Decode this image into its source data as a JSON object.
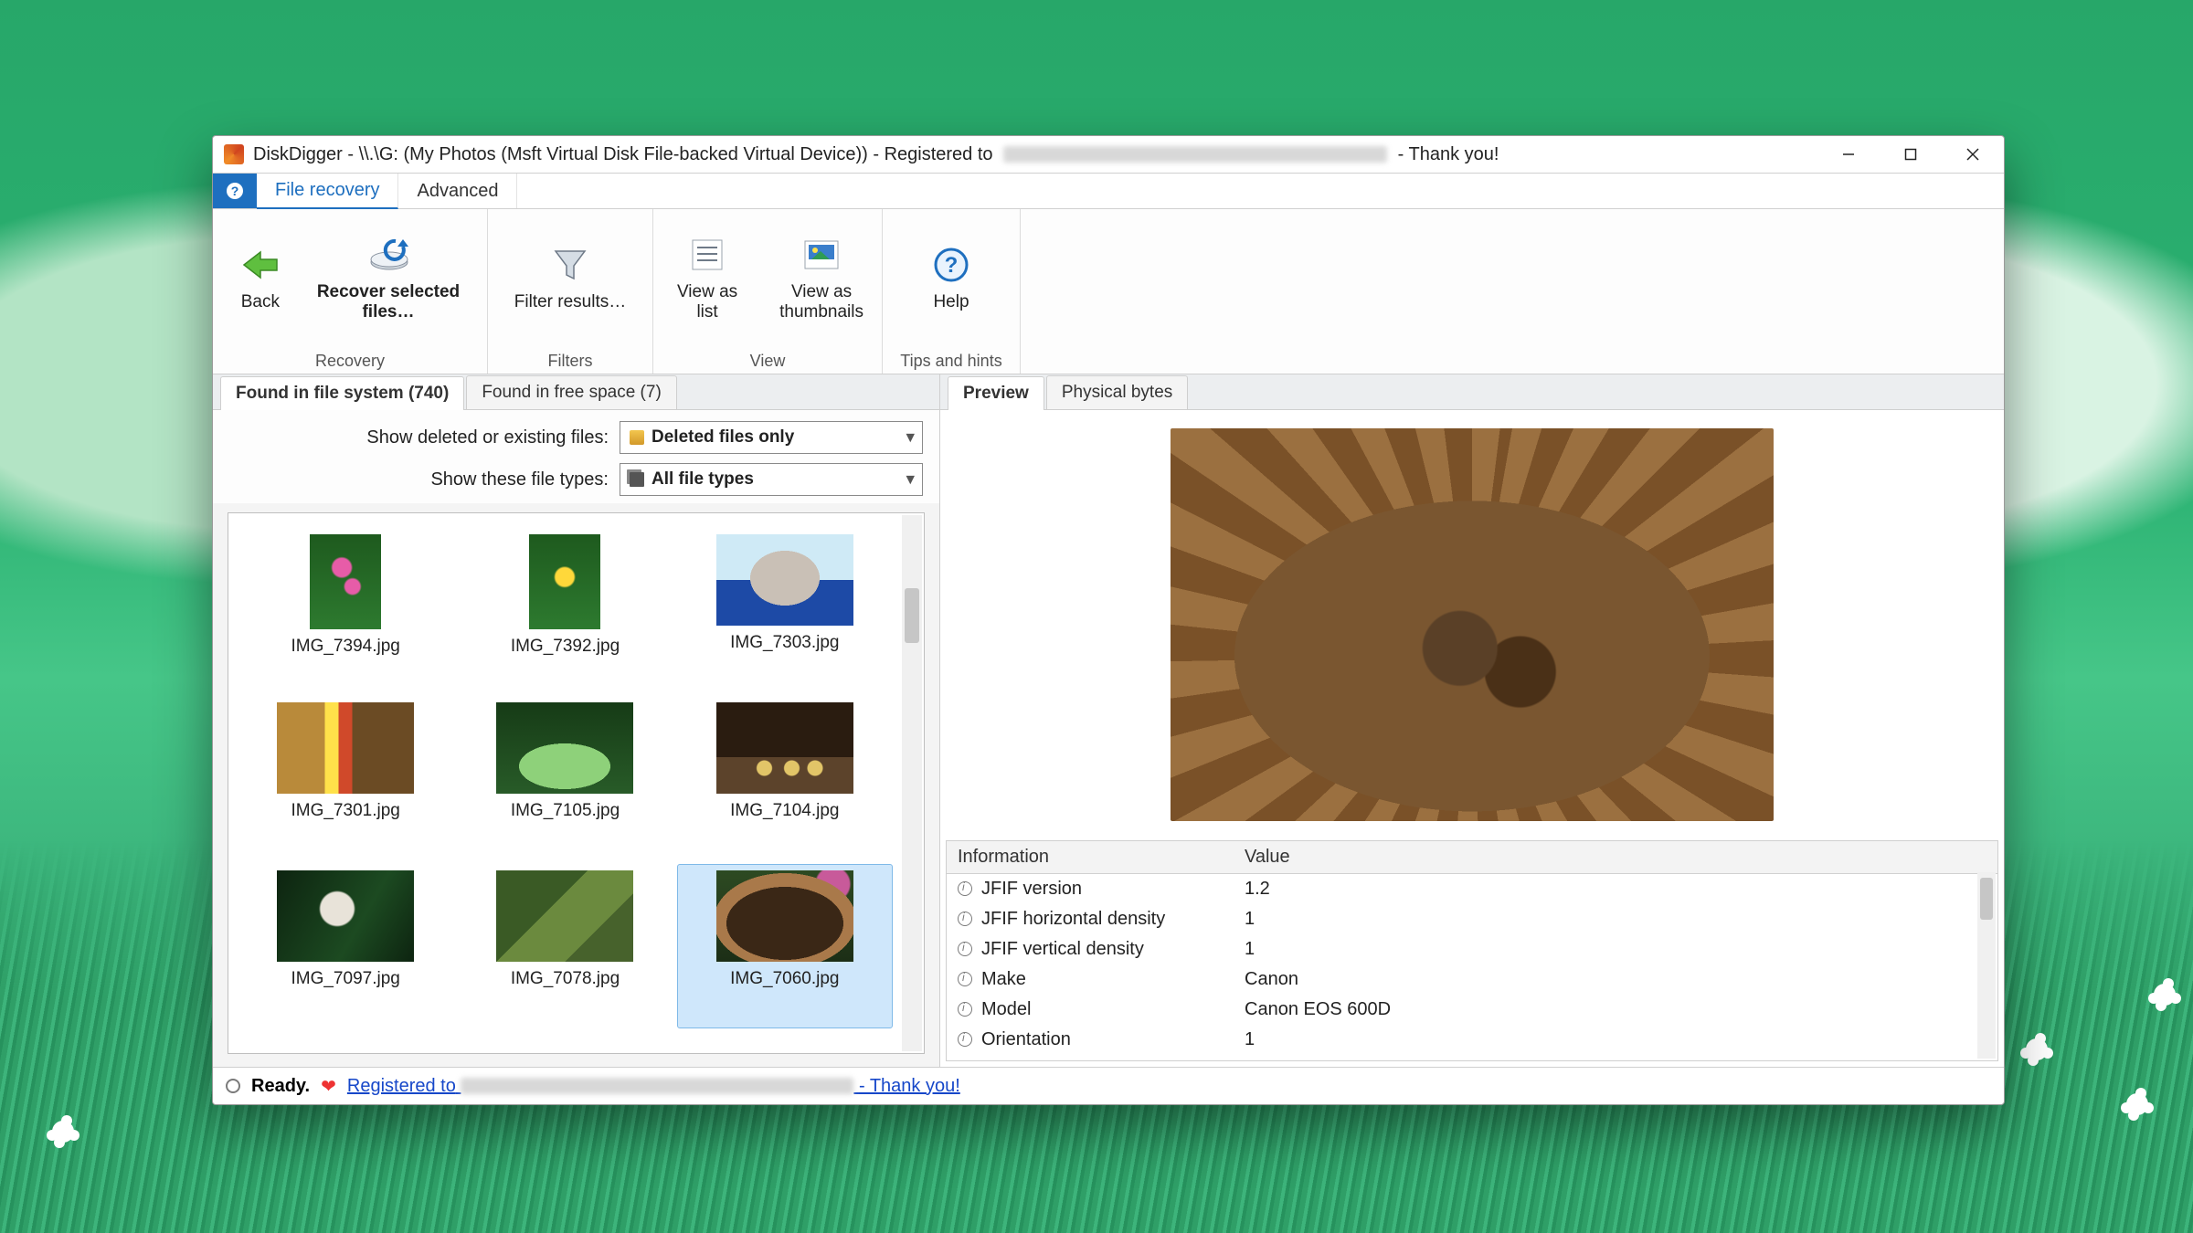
{
  "title": {
    "app": "DiskDigger",
    "path": "\\\\.\\G: (My Photos (Msft Virtual Disk File-backed Virtual Device))",
    "registered_pre": "Registered to",
    "thank": "- Thank you!"
  },
  "menuTabs": {
    "file_recovery": "File recovery",
    "advanced": "Advanced"
  },
  "ribbon": {
    "back": "Back",
    "recover": "Recover selected\nfiles…",
    "filter": "Filter results…",
    "view_list": "View as list",
    "view_thumb": "View as\nthumbnails",
    "help": "Help",
    "grp_recovery": "Recovery",
    "grp_filters": "Filters",
    "grp_view": "View",
    "grp_tips": "Tips and hints"
  },
  "leftTabs": {
    "fs": "Found in file system (740)",
    "free": "Found in free space (7)"
  },
  "filters": {
    "l1": "Show deleted or existing files:",
    "v1": "Deleted files only",
    "l2": "Show these file types:",
    "v2": "All file types"
  },
  "files": [
    {
      "name": "IMG_7394.jpg",
      "cls": "img-flower-pink",
      "portrait": true
    },
    {
      "name": "IMG_7392.jpg",
      "cls": "img-flower-yellow",
      "portrait": true
    },
    {
      "name": "IMG_7303.jpg",
      "cls": "img-kitten"
    },
    {
      "name": "IMG_7301.jpg",
      "cls": "img-barn1"
    },
    {
      "name": "IMG_7105.jpg",
      "cls": "img-greenhouse"
    },
    {
      "name": "IMG_7104.jpg",
      "cls": "img-ducks"
    },
    {
      "name": "IMG_7097.jpg",
      "cls": "img-monkey"
    },
    {
      "name": "IMG_7078.jpg",
      "cls": "img-pen"
    },
    {
      "name": "IMG_7060.jpg",
      "cls": "img-basket",
      "selected": true
    }
  ],
  "rightTabs": {
    "preview": "Preview",
    "bytes": "Physical bytes"
  },
  "info": {
    "h1": "Information",
    "h2": "Value",
    "rows": [
      {
        "k": "JFIF version",
        "v": "1.2"
      },
      {
        "k": "JFIF horizontal density",
        "v": "1"
      },
      {
        "k": "JFIF vertical density",
        "v": "1"
      },
      {
        "k": "Make",
        "v": "Canon"
      },
      {
        "k": "Model",
        "v": "Canon EOS 600D"
      },
      {
        "k": "Orientation",
        "v": "1"
      }
    ]
  },
  "status": {
    "ready": "Ready.",
    "reg": "Registered to",
    "thank": "- Thank you!"
  }
}
